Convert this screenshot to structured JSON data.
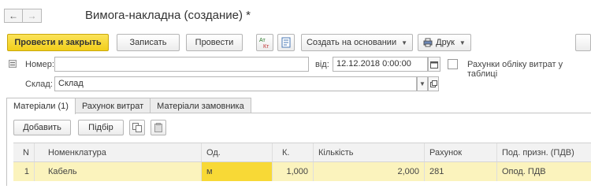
{
  "window": {
    "title": "Вимога-накладна (создание) *"
  },
  "nav": {
    "back": "←",
    "forward": "→"
  },
  "toolbar": {
    "post_and_close": "Провести и закрыть",
    "save": "Записать",
    "post": "Провести",
    "create_based_on": "Создать на основании",
    "print": "Друк"
  },
  "form": {
    "number_label": "Номер:",
    "number_value": "",
    "date_label": "від:",
    "date_value": "12.12.2018  0:00:00",
    "expense_accounts_label": "Рахунки обліку витрат у таблиці",
    "warehouse_label": "Склад:",
    "warehouse_value": "Склад"
  },
  "tabs": [
    {
      "label": "Матеріали (1)",
      "active": true
    },
    {
      "label": "Рахунок витрат",
      "active": false
    },
    {
      "label": "Матеріали замовника",
      "active": false
    }
  ],
  "table_toolbar": {
    "add": "Добавить",
    "select": "Підбір"
  },
  "table": {
    "columns": [
      "N",
      "Номенклатура",
      "Од.",
      "К.",
      "Кількість",
      "Рахунок",
      "Под. призн. (ПДВ)"
    ],
    "rows": [
      [
        "1",
        "Кабель",
        "м",
        "1,000",
        "2,000",
        "281",
        "Опод. ПДВ"
      ]
    ]
  }
}
